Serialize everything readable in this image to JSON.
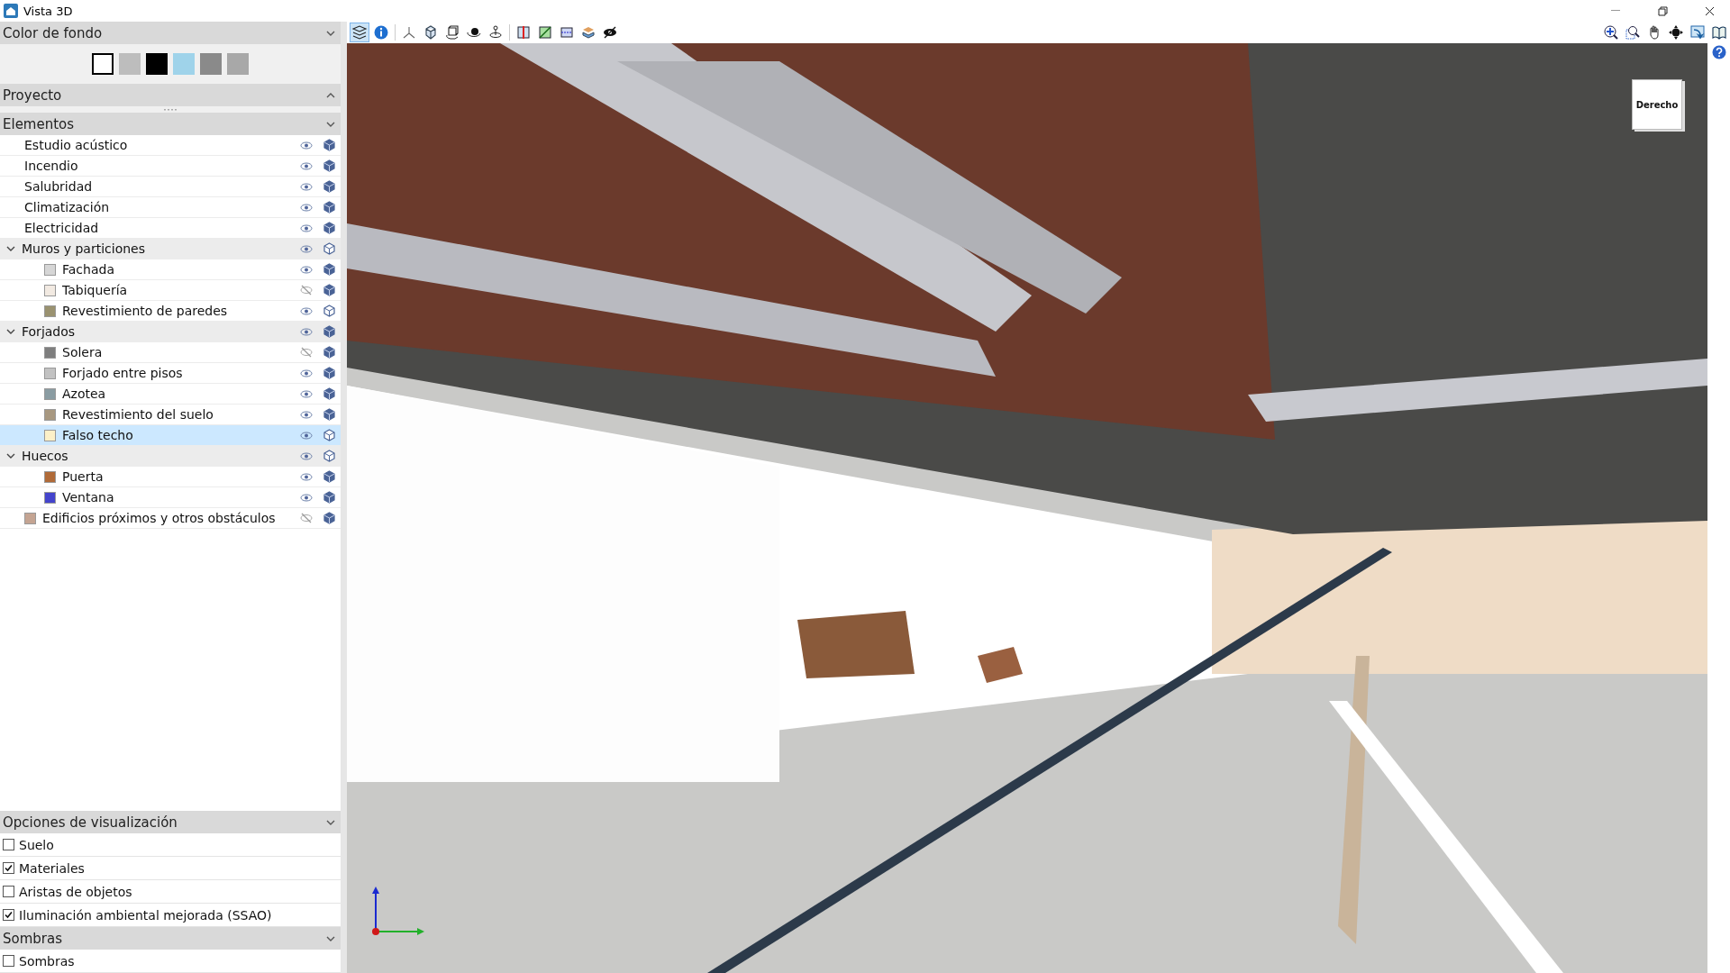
{
  "window": {
    "title": "Vista 3D"
  },
  "background_panel": {
    "title": "Color de fondo",
    "expanded": true,
    "swatches": [
      {
        "color": "#ffffff",
        "selected": true
      },
      {
        "color": "#bdbdbd",
        "selected": false
      },
      {
        "color": "#000000",
        "selected": false
      },
      {
        "color": "#9fd3ea",
        "selected": false
      },
      {
        "color": "#8a8a8a",
        "selected": false
      },
      {
        "color": "#a8a8a8",
        "selected": false
      }
    ]
  },
  "project_panel": {
    "title": "Proyecto",
    "expanded": false
  },
  "elements_panel": {
    "title": "Elementos",
    "expanded": true,
    "items": [
      {
        "label": "Estudio acústico",
        "visible": true,
        "solid": true,
        "selected": false
      },
      {
        "label": "Incendio",
        "visible": true,
        "solid": true,
        "selected": false
      },
      {
        "label": "Salubridad",
        "visible": true,
        "solid": true,
        "selected": false
      },
      {
        "label": "Climatización",
        "visible": true,
        "solid": true,
        "selected": false
      },
      {
        "label": "Electricidad",
        "visible": true,
        "solid": true,
        "selected": false
      },
      {
        "label": "Muros y particiones",
        "visible": true,
        "solid": false,
        "selected": false,
        "expanded": true,
        "children": [
          {
            "label": "Fachada",
            "color": "#d6d6d6",
            "visible": true,
            "solid": true,
            "selected": false
          },
          {
            "label": "Tabiquería",
            "color": "#f2eae2",
            "visible": false,
            "solid": true,
            "selected": false
          },
          {
            "label": "Revestimiento de paredes",
            "color": "#9a9270",
            "visible": true,
            "solid": false,
            "selected": false
          }
        ]
      },
      {
        "label": "Forjados",
        "visible": true,
        "solid": true,
        "selected": false,
        "expanded": true,
        "children": [
          {
            "label": "Solera",
            "color": "#7e7e7e",
            "visible": false,
            "solid": true,
            "selected": false
          },
          {
            "label": "Forjado entre pisos",
            "color": "#c2c2c2",
            "visible": true,
            "solid": true,
            "selected": false
          },
          {
            "label": "Azotea",
            "color": "#8a9ca2",
            "visible": true,
            "solid": true,
            "selected": false
          },
          {
            "label": "Revestimiento del suelo",
            "color": "#a89880",
            "visible": true,
            "solid": true,
            "selected": false
          },
          {
            "label": "Falso techo",
            "color": "#fcf0c8",
            "visible": true,
            "solid": false,
            "selected": true
          }
        ]
      },
      {
        "label": "Huecos",
        "visible": true,
        "solid": false,
        "selected": false,
        "expanded": true,
        "children": [
          {
            "label": "Puerta",
            "color": "#b06a38",
            "visible": true,
            "solid": true,
            "selected": false
          },
          {
            "label": "Ventana",
            "color": "#4444cc",
            "visible": true,
            "solid": true,
            "selected": false
          }
        ]
      },
      {
        "label": "Edificios próximos y otros obstáculos",
        "color": "#c4a492",
        "visible": false,
        "solid": true,
        "selected": false
      }
    ]
  },
  "display_panel": {
    "title": "Opciones de visualización",
    "expanded": true,
    "options": [
      {
        "label": "Suelo",
        "checked": false
      },
      {
        "label": "Materiales",
        "checked": true
      },
      {
        "label": "Aristas de objetos",
        "checked": false
      },
      {
        "label": "Iluminación ambiental mejorada (SSAO)",
        "checked": true
      }
    ]
  },
  "shadows_panel": {
    "title": "Sombras",
    "expanded": true,
    "options": [
      {
        "label": "Sombras",
        "checked": false
      }
    ]
  },
  "view_toolbar": [
    {
      "kind": "layers",
      "selected": true
    },
    {
      "kind": "info",
      "selected": false
    },
    {
      "kind": "axes",
      "selected": false
    },
    {
      "kind": "cube",
      "selected": false
    },
    {
      "kind": "orbit-box",
      "selected": false
    },
    {
      "kind": "orbit",
      "selected": false
    },
    {
      "kind": "rotate",
      "selected": false
    },
    {
      "kind": "section-red",
      "selected": false
    },
    {
      "kind": "section-green",
      "selected": false
    },
    {
      "kind": "section-blue",
      "selected": false
    },
    {
      "kind": "layers-3d",
      "selected": false
    },
    {
      "kind": "hide",
      "selected": false
    }
  ],
  "nav_toolbar": [
    {
      "kind": "zoom-extents"
    },
    {
      "kind": "zoom-window"
    },
    {
      "kind": "pan"
    },
    {
      "kind": "move"
    },
    {
      "kind": "view-change"
    },
    {
      "kind": "book"
    }
  ],
  "view_cube": {
    "label": "Derecho"
  }
}
